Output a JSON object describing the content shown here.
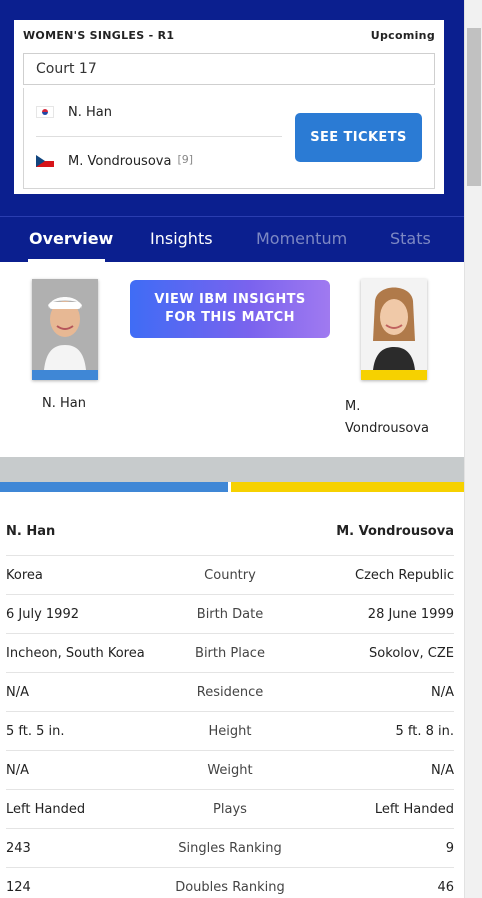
{
  "match": {
    "event": "WOMEN'S SINGLES - R1",
    "status": "Upcoming",
    "court": "Court 17",
    "tickets_label": "SEE TICKETS"
  },
  "players": [
    {
      "name": "N. Han",
      "flag": "korea-flag-icon",
      "seed": ""
    },
    {
      "name": "M. Vondrousova",
      "flag": "czech-flag-icon",
      "seed": "[9]"
    }
  ],
  "tabs": [
    {
      "label": "Overview",
      "active": true
    },
    {
      "label": "Insights",
      "active": false
    },
    {
      "label": "Momentum",
      "active": false
    },
    {
      "label": "Stats",
      "active": false
    }
  ],
  "insights_button": {
    "line1": "VIEW IBM INSIGHTS",
    "line2": "FOR THIS MATCH"
  },
  "profile": {
    "left_name": "N. Han",
    "right_name_line1": "M.",
    "right_name_line2": "Vondrousova"
  },
  "colors": {
    "left_player": "#3f87d6",
    "right_player": "#f6d100",
    "header": "#0b1f8f",
    "button": "#2b7bd4"
  },
  "comparison": {
    "header_left": "N. Han",
    "header_right": "M. Vondrousova",
    "rows": [
      {
        "label": "Country",
        "left": "Korea",
        "right": "Czech Republic"
      },
      {
        "label": "Birth Date",
        "left": "6 July 1992",
        "right": "28 June 1999"
      },
      {
        "label": "Birth Place",
        "left": "Incheon, South Korea",
        "right": "Sokolov, CZE"
      },
      {
        "label": "Residence",
        "left": "N/A",
        "right": "N/A"
      },
      {
        "label": "Height",
        "left": "5 ft. 5 in.",
        "right": "5 ft. 8 in."
      },
      {
        "label": "Weight",
        "left": "N/A",
        "right": "N/A"
      },
      {
        "label": "Plays",
        "left": "Left Handed",
        "right": "Left Handed"
      },
      {
        "label": "Singles Ranking",
        "left": "243",
        "right": "9"
      },
      {
        "label": "Doubles Ranking",
        "left": "124",
        "right": "46"
      }
    ]
  }
}
